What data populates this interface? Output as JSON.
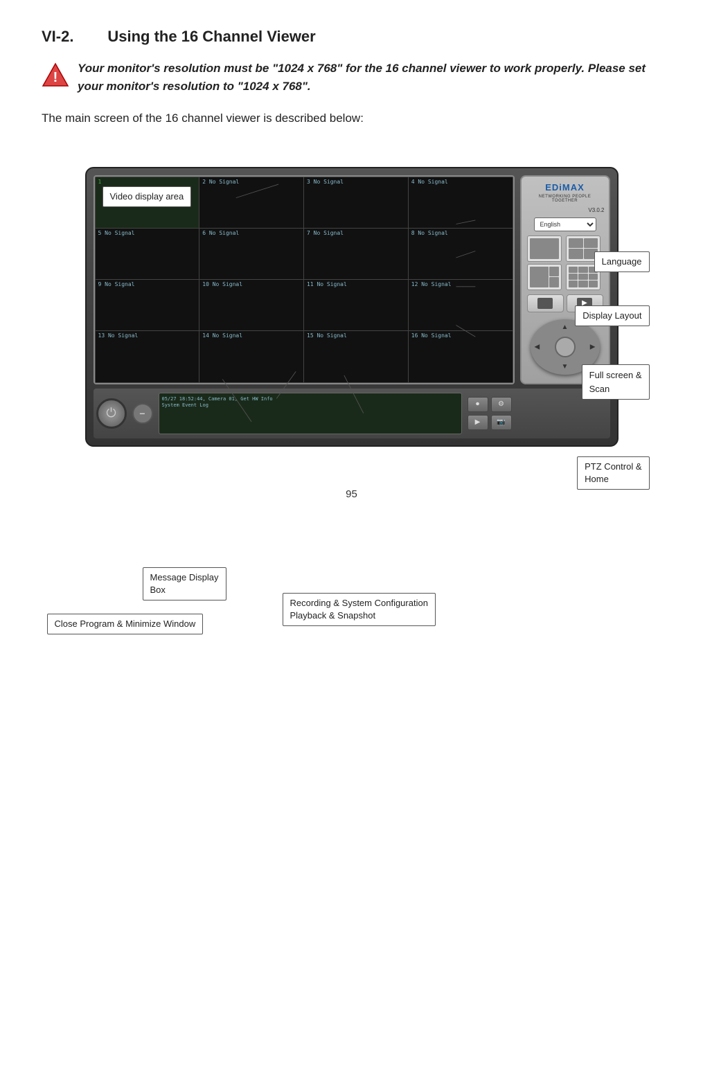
{
  "page": {
    "title": "VI-2.",
    "subtitle": "Using the 16 Channel Viewer",
    "warning": {
      "text": "Your monitor's resolution must be \"1024 x 768\" for the 16 channel viewer to work properly. Please set your monitor's resolution to \"1024 x 768\"."
    },
    "intro": "The main screen of the 16 channel viewer is described below:",
    "page_number": "95"
  },
  "callouts": {
    "video_display_area": "Video display area",
    "language": "Language",
    "display_layout": "Display Layout",
    "full_screen_scan": "Full screen &\nScan",
    "ptz_control": "PTZ Control &\nHome",
    "message_display_box": "Message Display\nBox",
    "recording_system": "Recording & System Configuration\nPlayback & Snapshot",
    "close_program": "Close Program & Minimize Window"
  },
  "video_cells": [
    {
      "label": "1"
    },
    {
      "label": "2 No Signal"
    },
    {
      "label": "3 No Signal"
    },
    {
      "label": "4 No Signal"
    },
    {
      "label": "5 No Signal"
    },
    {
      "label": "6 No Signal"
    },
    {
      "label": "7 No Signal"
    },
    {
      "label": "8 No Signal"
    },
    {
      "label": "9 No Signal"
    },
    {
      "label": "10 No Signal"
    },
    {
      "label": "11 No Signal"
    },
    {
      "label": "12 No Signal"
    },
    {
      "label": "13 No Signal"
    },
    {
      "label": "14 No Signal"
    },
    {
      "label": "15 No Signal"
    },
    {
      "label": "16 No Signal"
    }
  ],
  "brand": {
    "name": "EDiMAX",
    "tagline": "NETWORKING PEOPLE TOGETHER",
    "version": "V3.0.2"
  },
  "language_options": [
    "English"
  ],
  "messages": [
    "05/27 18:52:44, Camera 01, Get HW Info",
    "System Event Log"
  ]
}
